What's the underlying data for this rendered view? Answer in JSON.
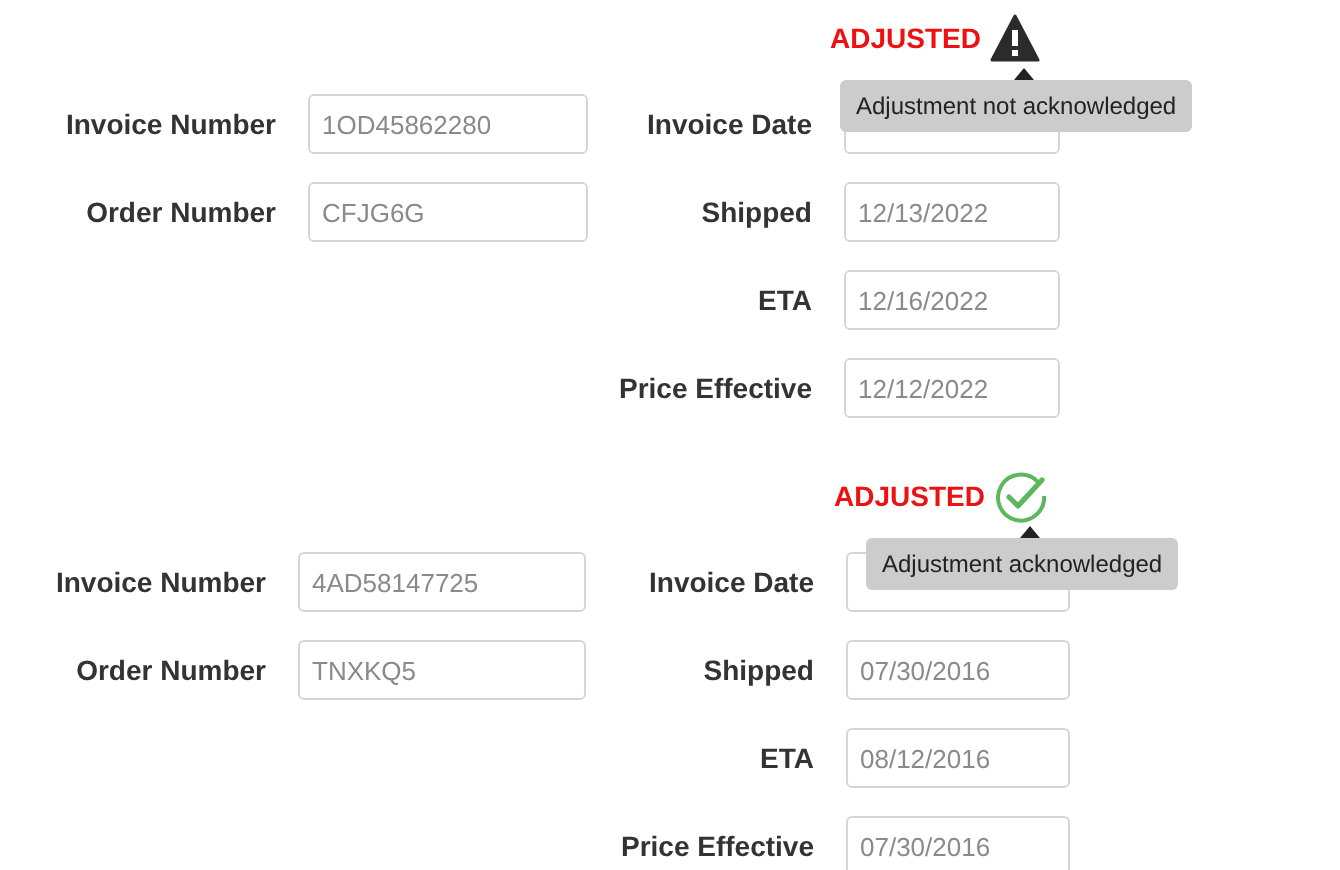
{
  "blocks": [
    {
      "adjusted_label": "ADJUSTED",
      "kind": "warning",
      "tooltip": "Adjustment not acknowledged",
      "left_fields": [
        {
          "label": "Invoice Number",
          "value": "1OD45862280"
        },
        {
          "label": "Order Number",
          "value": "CFJG6G"
        }
      ],
      "right_fields": [
        {
          "label": "Invoice Date"
        },
        {
          "label": "Shipped",
          "value": "12/13/2022"
        },
        {
          "label": "ETA",
          "value": "12/16/2022"
        },
        {
          "label": "Price Effective",
          "value": "12/12/2022"
        }
      ]
    },
    {
      "adjusted_label": "ADJUSTED",
      "kind": "acknowledged",
      "tooltip": "Adjustment acknowledged",
      "left_fields": [
        {
          "label": "Invoice Number",
          "value": "4AD58147725"
        },
        {
          "label": "Order Number",
          "value": "TNXKQ5"
        }
      ],
      "right_fields": [
        {
          "label": "Invoice Date"
        },
        {
          "label": "Shipped",
          "value": "07/30/2016"
        },
        {
          "label": "ETA",
          "value": "08/12/2016"
        },
        {
          "label": "Price Effective",
          "value": "07/30/2016"
        }
      ]
    }
  ]
}
